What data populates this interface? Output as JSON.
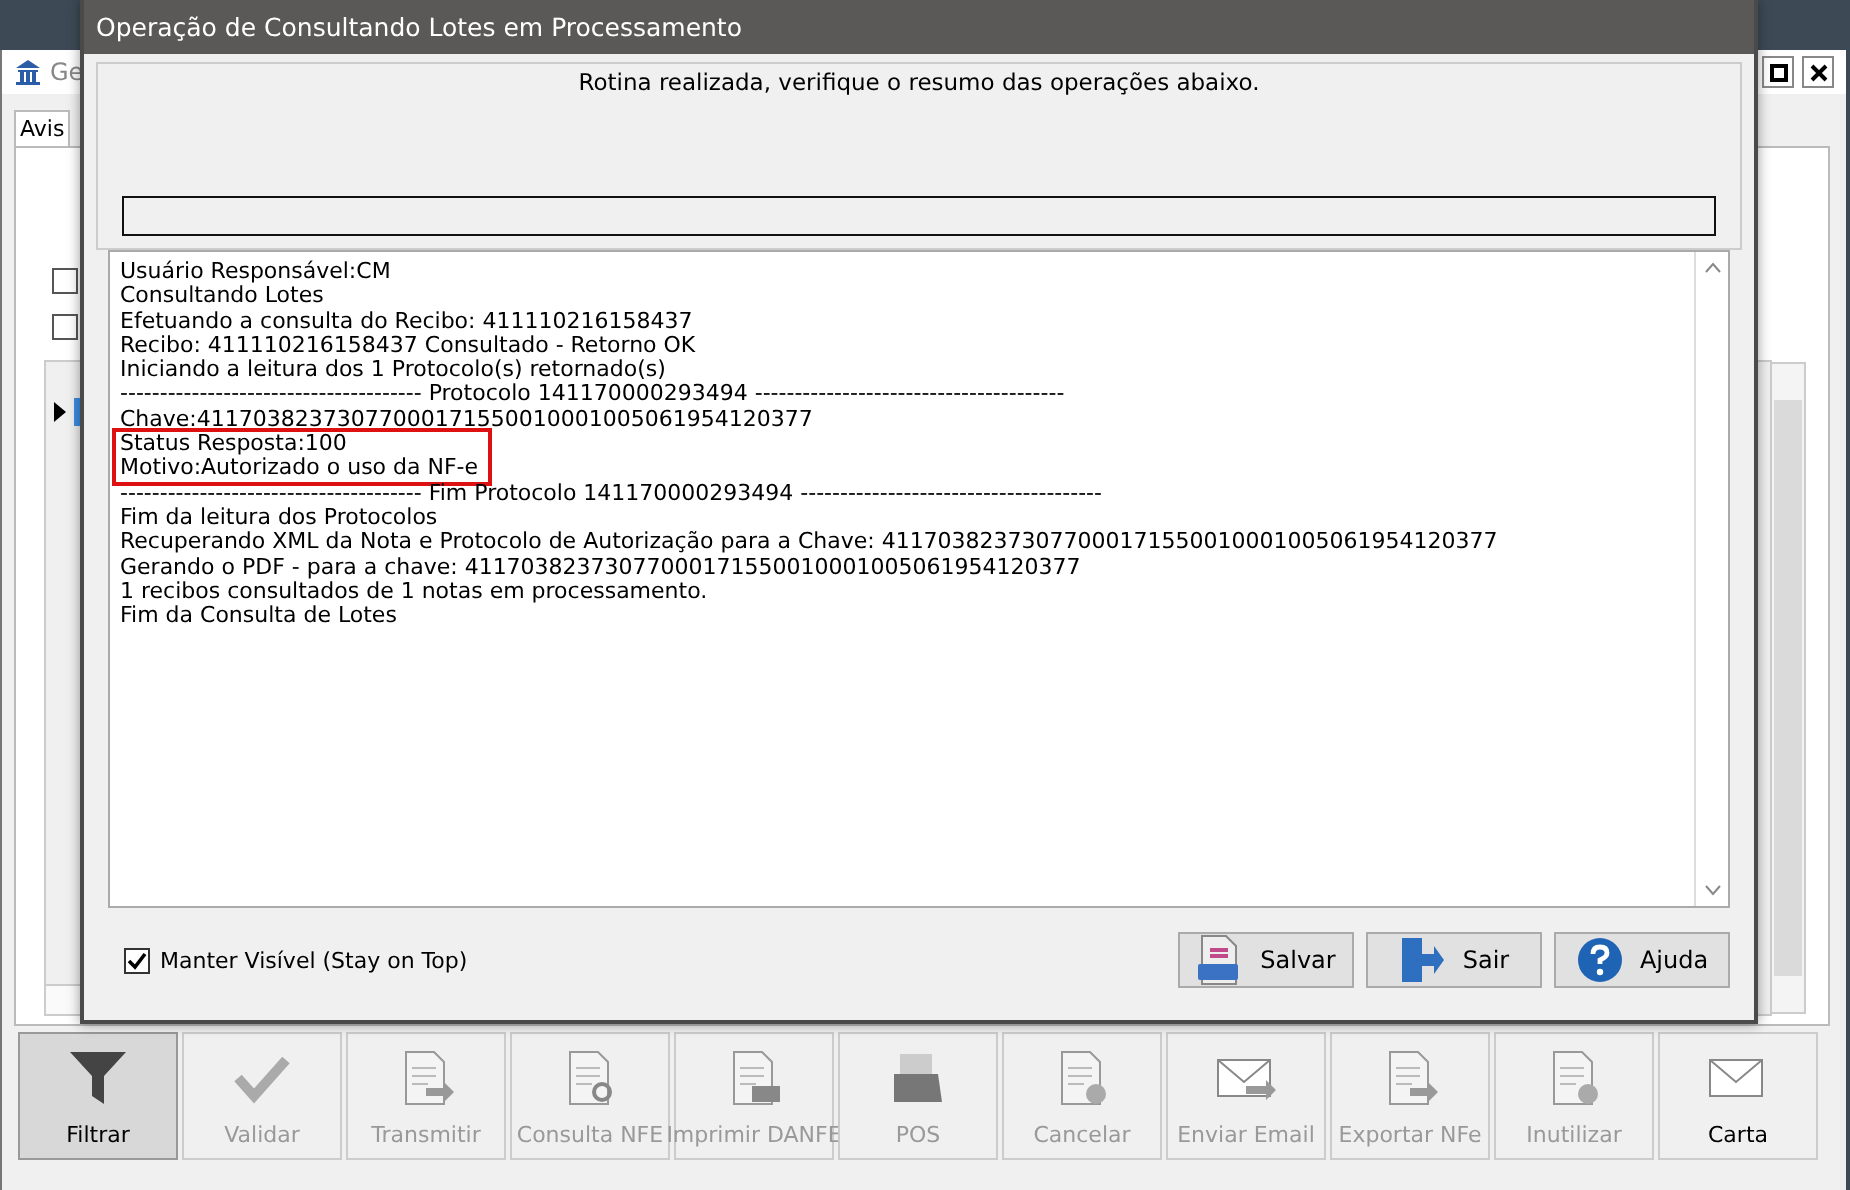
{
  "app": {
    "title": "Ge",
    "tab": "Avis",
    "options": [
      {
        "checked": false
      },
      {
        "checked": false
      }
    ],
    "toolbar": [
      {
        "label": "Filtrar",
        "disabled": false,
        "selected": true
      },
      {
        "label": "Validar",
        "disabled": true,
        "selected": false
      },
      {
        "label": "Transmitir",
        "disabled": true,
        "selected": false
      },
      {
        "label": "Consulta NFE",
        "disabled": true,
        "selected": false
      },
      {
        "label": "Imprimir DANFE",
        "disabled": true,
        "selected": false
      },
      {
        "label": "POS",
        "disabled": true,
        "selected": false
      },
      {
        "label": "Cancelar",
        "disabled": true,
        "selected": false
      },
      {
        "label": "Enviar Email",
        "disabled": true,
        "selected": false
      },
      {
        "label": "Exportar NFe",
        "disabled": true,
        "selected": false
      },
      {
        "label": "Inutilizar",
        "disabled": true,
        "selected": false
      },
      {
        "label": "Carta",
        "disabled": false,
        "selected": false
      }
    ]
  },
  "dialog": {
    "title": "Operação de Consultando Lotes em Processamento",
    "message": "Rotina realizada, verifique o resumo das operações abaixo.",
    "progress": {
      "level": 0
    },
    "log": [
      "Usuário Responsável:CM",
      "Consultando Lotes",
      "Efetuando a consulta do Recibo: 411110216158437",
      "Recibo: 411110216158437 Consultado - Retorno OK",
      "Iniciando a leitura dos 1 Protocolo(s) retornado(s)",
      "-------------------------------------- Protocolo 141170000293494 ---------------------------------------",
      "Chave:41170382373077000171550010001005061954120377",
      "Status Resposta:100",
      "Motivo:Autorizado o uso da NF-e",
      "-------------------------------------- Fim Protocolo 141170000293494 --------------------------------------",
      "Fim da leitura dos Protocolos",
      "Recuperando XML da Nota e Protocolo de Autorização para a Chave: 41170382373077000171550010001005061954120377",
      "Gerando o PDF - para a chave: 41170382373077000171550010001005061954120377",
      "1 recibos consultados de 1 notas em processamento.",
      "Fim da Consulta de Lotes"
    ],
    "stay_on_top": {
      "label": "Manter Visível (Stay on Top)",
      "checked": true
    },
    "buttons": [
      {
        "label": "Salvar"
      },
      {
        "label": "Sair"
      },
      {
        "label": "Ajuda"
      }
    ]
  }
}
